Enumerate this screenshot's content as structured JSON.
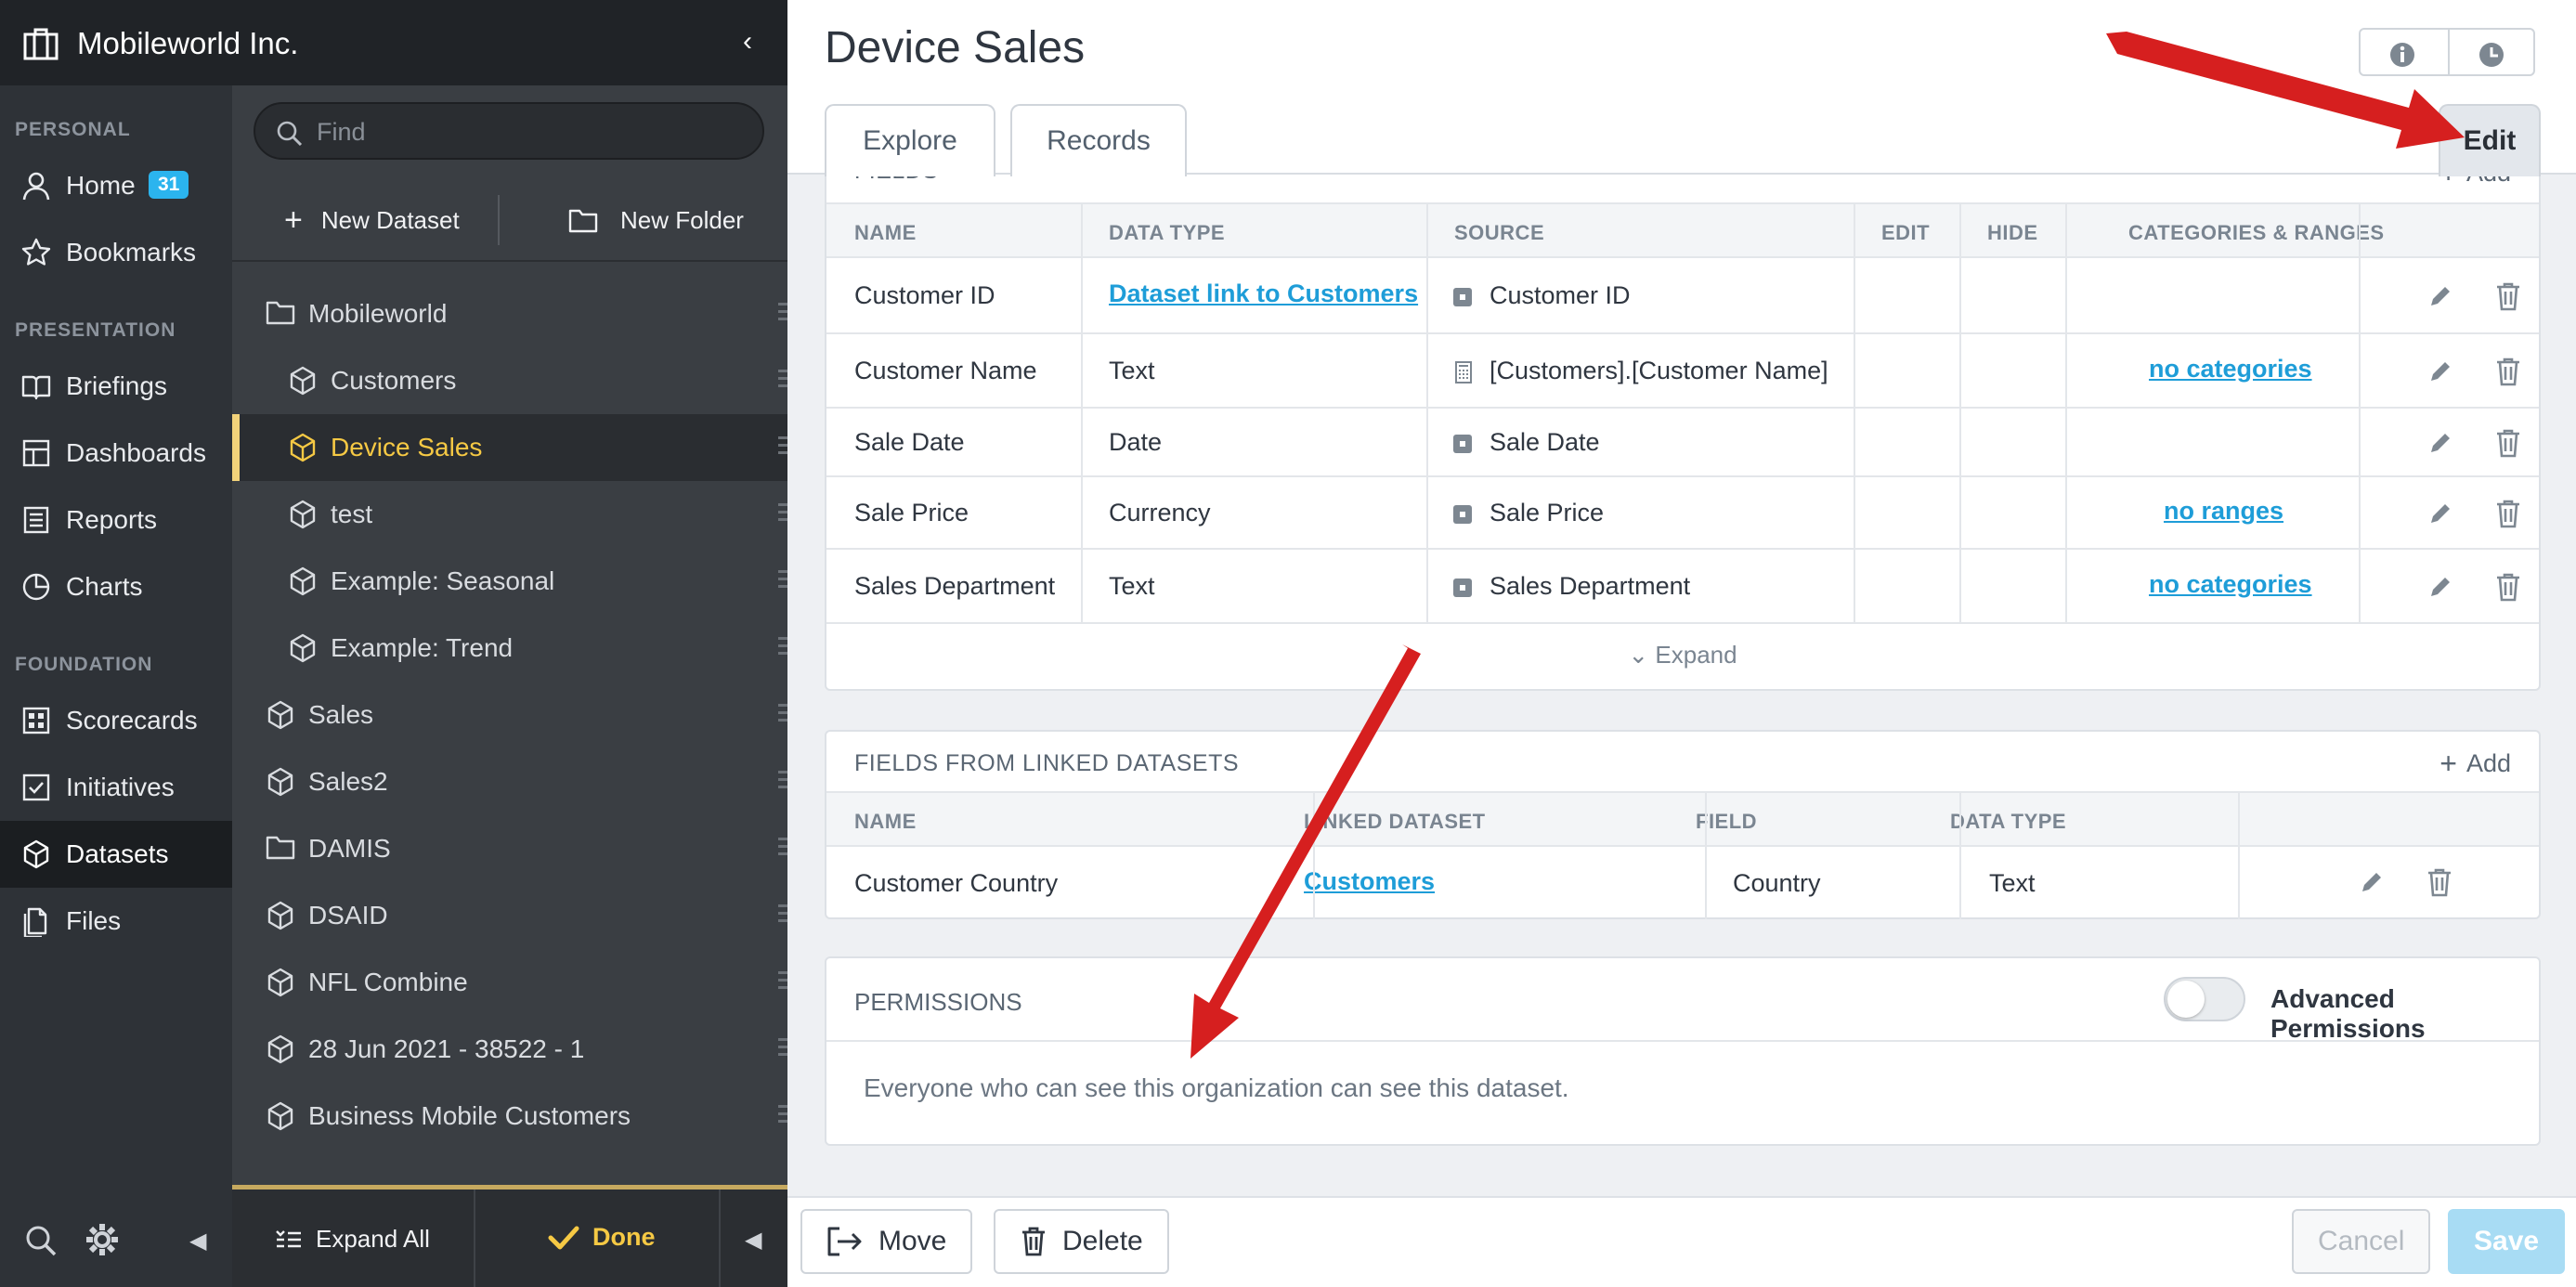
{
  "org": {
    "name": "Mobileworld Inc."
  },
  "nav": {
    "sections": [
      "PERSONAL",
      "PRESENTATION",
      "FOUNDATION"
    ],
    "items": [
      {
        "label": "Home",
        "badge": "31",
        "icon": "user-icon"
      },
      {
        "label": "Bookmarks",
        "icon": "star-icon"
      },
      {
        "label": "Briefings",
        "icon": "book-icon"
      },
      {
        "label": "Dashboards",
        "icon": "dashboard-icon"
      },
      {
        "label": "Reports",
        "icon": "report-icon"
      },
      {
        "label": "Charts",
        "icon": "pie-chart-icon"
      },
      {
        "label": "Scorecards",
        "icon": "scorecard-icon"
      },
      {
        "label": "Initiatives",
        "icon": "checkbox-icon"
      },
      {
        "label": "Datasets",
        "icon": "cube-icon",
        "active": true
      },
      {
        "label": "Files",
        "icon": "file-icon"
      }
    ]
  },
  "tree": {
    "search_placeholder": "Find",
    "new_dataset": "New Dataset",
    "new_folder": "New Folder",
    "rows": [
      {
        "label": "Mobileworld",
        "type": "folder",
        "level": 0
      },
      {
        "label": "Customers",
        "type": "dataset",
        "level": 1
      },
      {
        "label": "Device Sales",
        "type": "dataset",
        "level": 1,
        "selected": true
      },
      {
        "label": "test",
        "type": "dataset",
        "level": 1
      },
      {
        "label": "Example: Seasonal",
        "type": "dataset",
        "level": 1
      },
      {
        "label": "Example: Trend",
        "type": "dataset",
        "level": 1
      },
      {
        "label": "Sales",
        "type": "dataset",
        "level": 0
      },
      {
        "label": "Sales2",
        "type": "dataset",
        "level": 0
      },
      {
        "label": "DAMIS",
        "type": "folder",
        "level": 0
      },
      {
        "label": "DSAID",
        "type": "dataset",
        "level": 0
      },
      {
        "label": "NFL Combine",
        "type": "dataset",
        "level": 0
      },
      {
        "label": "28 Jun 2021 - 38522 - 1",
        "type": "dataset",
        "level": 0
      },
      {
        "label": "Business Mobile Customers",
        "type": "dataset",
        "level": 0
      }
    ],
    "expand_all": "Expand All",
    "done": "Done"
  },
  "page": {
    "title": "Device Sales",
    "tabs": [
      "Explore",
      "Records",
      "Edit"
    ],
    "active_tab": "Edit"
  },
  "fields": {
    "title": "FIELDS",
    "add": "Add",
    "columns": [
      "NAME",
      "DATA TYPE",
      "SOURCE",
      "EDIT",
      "HIDE",
      "CATEGORIES & RANGES"
    ],
    "rows": [
      {
        "name": "Customer ID",
        "type": "Dataset link to Customers",
        "type_is_link": true,
        "source": "Customer ID",
        "source_icon": "column-icon",
        "cat": ""
      },
      {
        "name": "Customer Name",
        "type": "Text",
        "source": "[Customers].[Customer Name]",
        "source_icon": "calculator-icon",
        "cat": "no categories"
      },
      {
        "name": "Sale Date",
        "type": "Date",
        "source": "Sale Date",
        "source_icon": "column-icon",
        "cat": ""
      },
      {
        "name": "Sale Price",
        "type": "Currency",
        "source": "Sale Price",
        "source_icon": "column-icon",
        "cat": "no ranges"
      },
      {
        "name": "Sales Department",
        "type": "Text",
        "source": "Sales Department",
        "source_icon": "column-icon",
        "cat": "no categories"
      }
    ],
    "expand": "Expand"
  },
  "linked": {
    "title": "FIELDS FROM LINKED DATASETS",
    "add": "Add",
    "columns": [
      "NAME",
      "LINKED DATASET",
      "FIELD",
      "DATA TYPE"
    ],
    "rows": [
      {
        "name": "Customer Country",
        "dataset": "Customers",
        "field": "Country",
        "type": "Text"
      }
    ]
  },
  "permissions": {
    "title": "PERMISSIONS",
    "toggle_label": "Advanced Permissions",
    "toggle_on": false,
    "text": "Everyone who can see this organization can see this dataset."
  },
  "footer": {
    "move": "Move",
    "delete": "Delete",
    "cancel": "Cancel",
    "save": "Save"
  },
  "colors": {
    "accent": "#2bb4ee",
    "link": "#1e9dd8",
    "selected": "#f6c944",
    "annotation_arrow": "#d61f1f"
  }
}
